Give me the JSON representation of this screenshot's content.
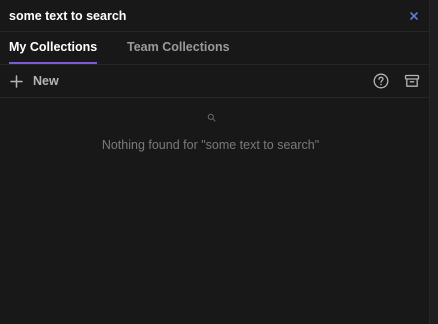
{
  "search": {
    "value": "some text to search",
    "placeholder": ""
  },
  "tabs": [
    {
      "label": "My Collections",
      "active": true
    },
    {
      "label": "Team Collections",
      "active": false
    }
  ],
  "toolbar": {
    "new_label": "New",
    "icons": [
      "help-circle-icon",
      "archive-icon"
    ]
  },
  "empty_state": {
    "icon": "search-icon",
    "message": "Nothing found for \"some text to search\""
  },
  "colors": {
    "background": "#181818",
    "accent": "#7c5cd6",
    "clear_icon": "#5b7bd5",
    "text_primary": "#ffffff",
    "text_secondary": "#9a9a9a",
    "text_muted": "#7a7a7a"
  }
}
